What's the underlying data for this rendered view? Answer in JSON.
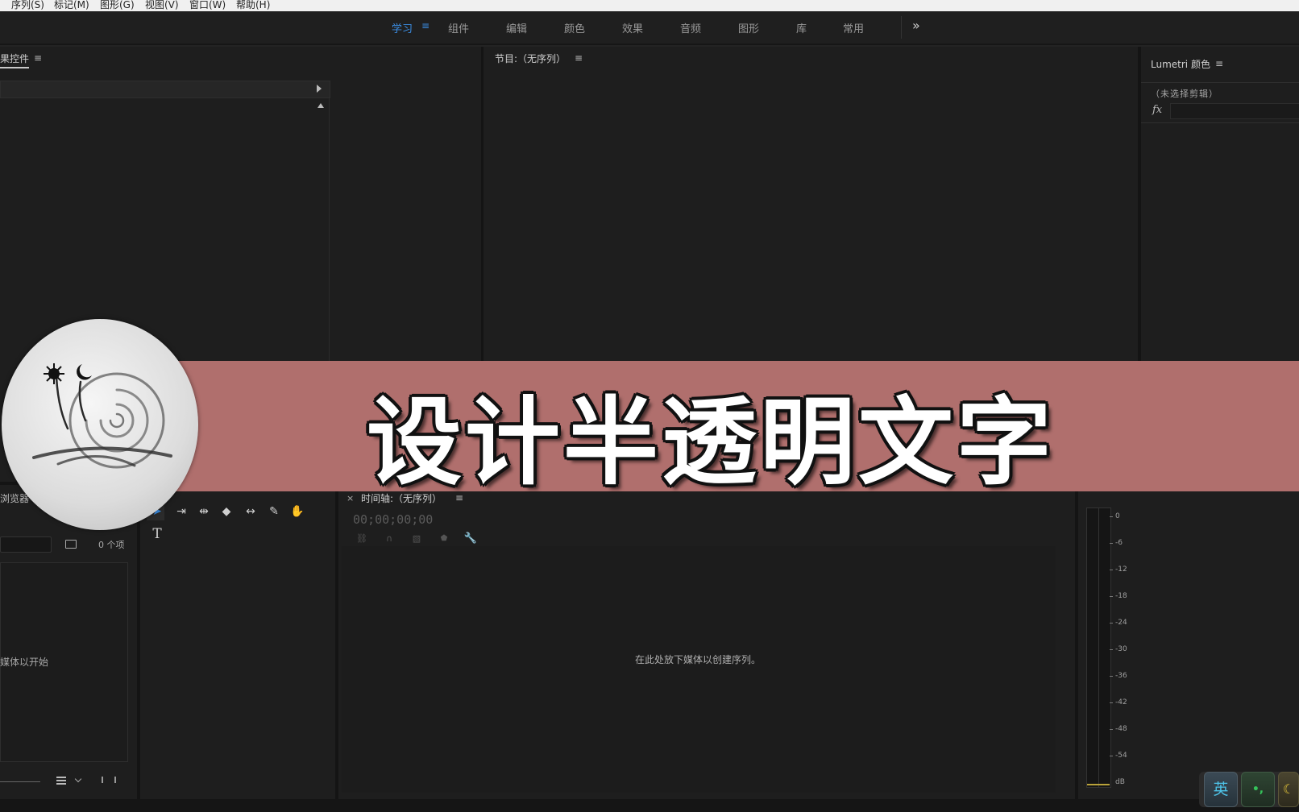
{
  "menu": [
    "序列(S)",
    "标记(M)",
    "图形(G)",
    "视图(V)",
    "窗口(W)",
    "帮助(H)"
  ],
  "workspaces": {
    "tabs": [
      {
        "label": "学习",
        "active": true
      },
      {
        "label": "组件",
        "active": false
      },
      {
        "label": "编辑",
        "active": false
      },
      {
        "label": "颜色",
        "active": false
      },
      {
        "label": "效果",
        "active": false
      },
      {
        "label": "音频",
        "active": false
      },
      {
        "label": "图形",
        "active": false
      },
      {
        "label": "库",
        "active": false
      },
      {
        "label": "常用",
        "active": false
      }
    ],
    "overflow": "»",
    "menu_icon": "≡"
  },
  "effect_controls": {
    "title": "果控件",
    "menu_icon": "≡"
  },
  "program_monitor": {
    "title": "节目:（无序列）",
    "menu_icon": "≡"
  },
  "lumetri": {
    "title": "Lumetri 颜色",
    "menu_icon": "≡",
    "no_clip": "（未选择剪辑）",
    "fx": "fx"
  },
  "project_panel": {
    "title": "浏览器",
    "items_count": "0 个项",
    "hint": "媒体以开始"
  },
  "timeline": {
    "close": "×",
    "title": "时间轴:（无序列）",
    "menu_icon": "≡",
    "timecode": "00;00;00;00",
    "empty_hint": "在此处放下媒体以创建序列。"
  },
  "audio_meter": {
    "ticks": [
      "0",
      "-6",
      "-12",
      "-18",
      "-24",
      "-30",
      "-36",
      "-42",
      "-48",
      "-54",
      "dB"
    ]
  },
  "tools": {
    "type_tool": "T"
  },
  "banner": {
    "title": "设计半透明文字",
    "color": "#b06f6d"
  },
  "ime": {
    "lang": "英",
    "punct": "•,"
  }
}
